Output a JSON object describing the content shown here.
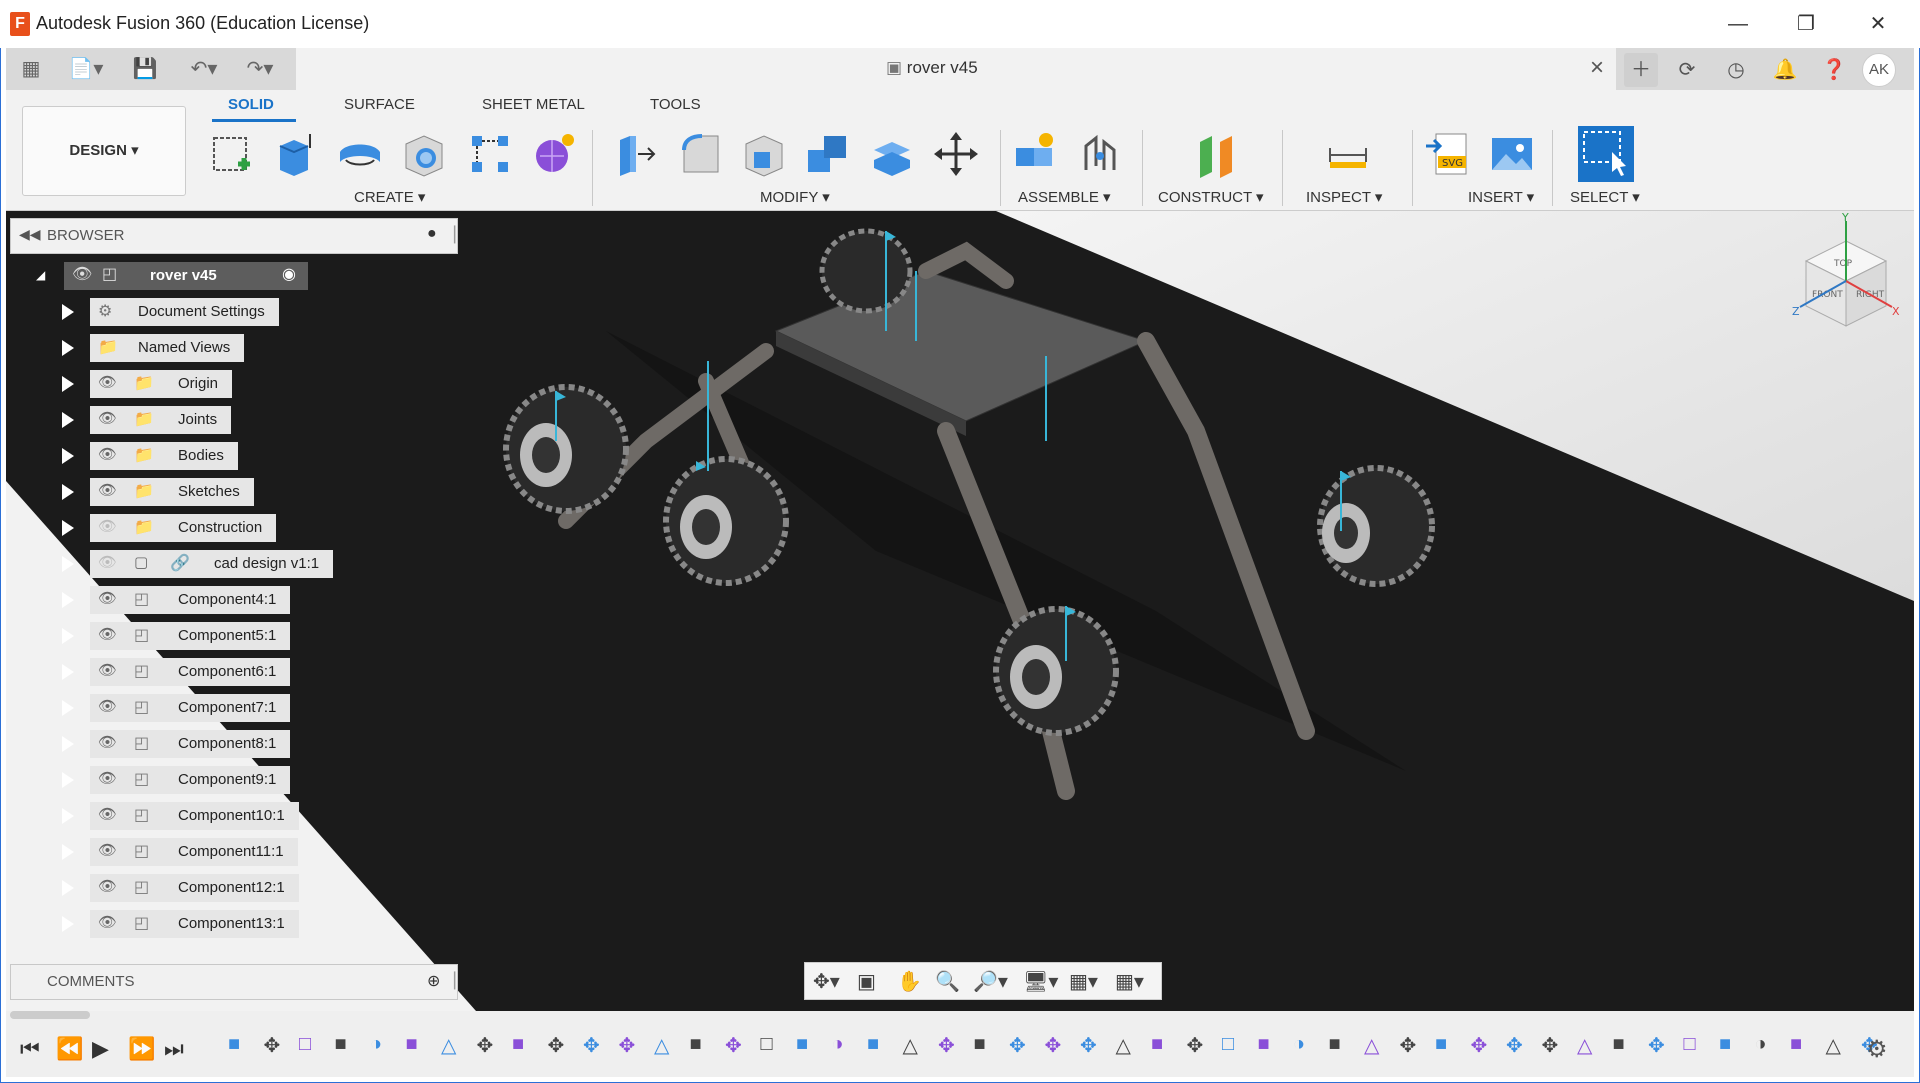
{
  "app": {
    "window_title": "Autodesk Fusion 360 (Education License)",
    "logo_letter": "F"
  },
  "document_tab": {
    "label": "rover v45"
  },
  "user": {
    "initials": "AK"
  },
  "ribbon": {
    "tabs": [
      "SOLID",
      "SURFACE",
      "SHEET METAL",
      "TOOLS"
    ],
    "active_tab": "SOLID",
    "workspace": "DESIGN",
    "groups": [
      "CREATE",
      "MODIFY",
      "ASSEMBLE",
      "CONSTRUCT",
      "INSPECT",
      "INSERT",
      "SELECT"
    ]
  },
  "browser": {
    "title": "BROWSER",
    "root": "rover v45",
    "items": [
      {
        "label": "Document Settings",
        "type": "settings"
      },
      {
        "label": "Named Views",
        "type": "folder"
      },
      {
        "label": "Origin",
        "type": "folder"
      },
      {
        "label": "Joints",
        "type": "folder"
      },
      {
        "label": "Bodies",
        "type": "folder"
      },
      {
        "label": "Sketches",
        "type": "folder"
      },
      {
        "label": "Construction",
        "type": "folder"
      },
      {
        "label": "cad design v1:1",
        "type": "link"
      },
      {
        "label": "Component4:1",
        "type": "component"
      },
      {
        "label": "Component5:1",
        "type": "component"
      },
      {
        "label": "Component6:1",
        "type": "component"
      },
      {
        "label": "Component7:1",
        "type": "component"
      },
      {
        "label": "Component8:1",
        "type": "component"
      },
      {
        "label": "Component9:1",
        "type": "component"
      },
      {
        "label": "Component10:1",
        "type": "component"
      },
      {
        "label": "Component11:1",
        "type": "component"
      },
      {
        "label": "Component12:1",
        "type": "component"
      },
      {
        "label": "Component13:1",
        "type": "component"
      }
    ]
  },
  "comments": {
    "title": "COMMENTS"
  },
  "viewcube": {
    "faces": [
      "FRONT",
      "TOP",
      "RIGHT"
    ],
    "axes": [
      "X",
      "Y",
      "Z"
    ]
  },
  "colors": {
    "accent": "#1a73c8",
    "viewport_bg": "#1e1e1e",
    "panel_bg": "#f2f2f2"
  }
}
